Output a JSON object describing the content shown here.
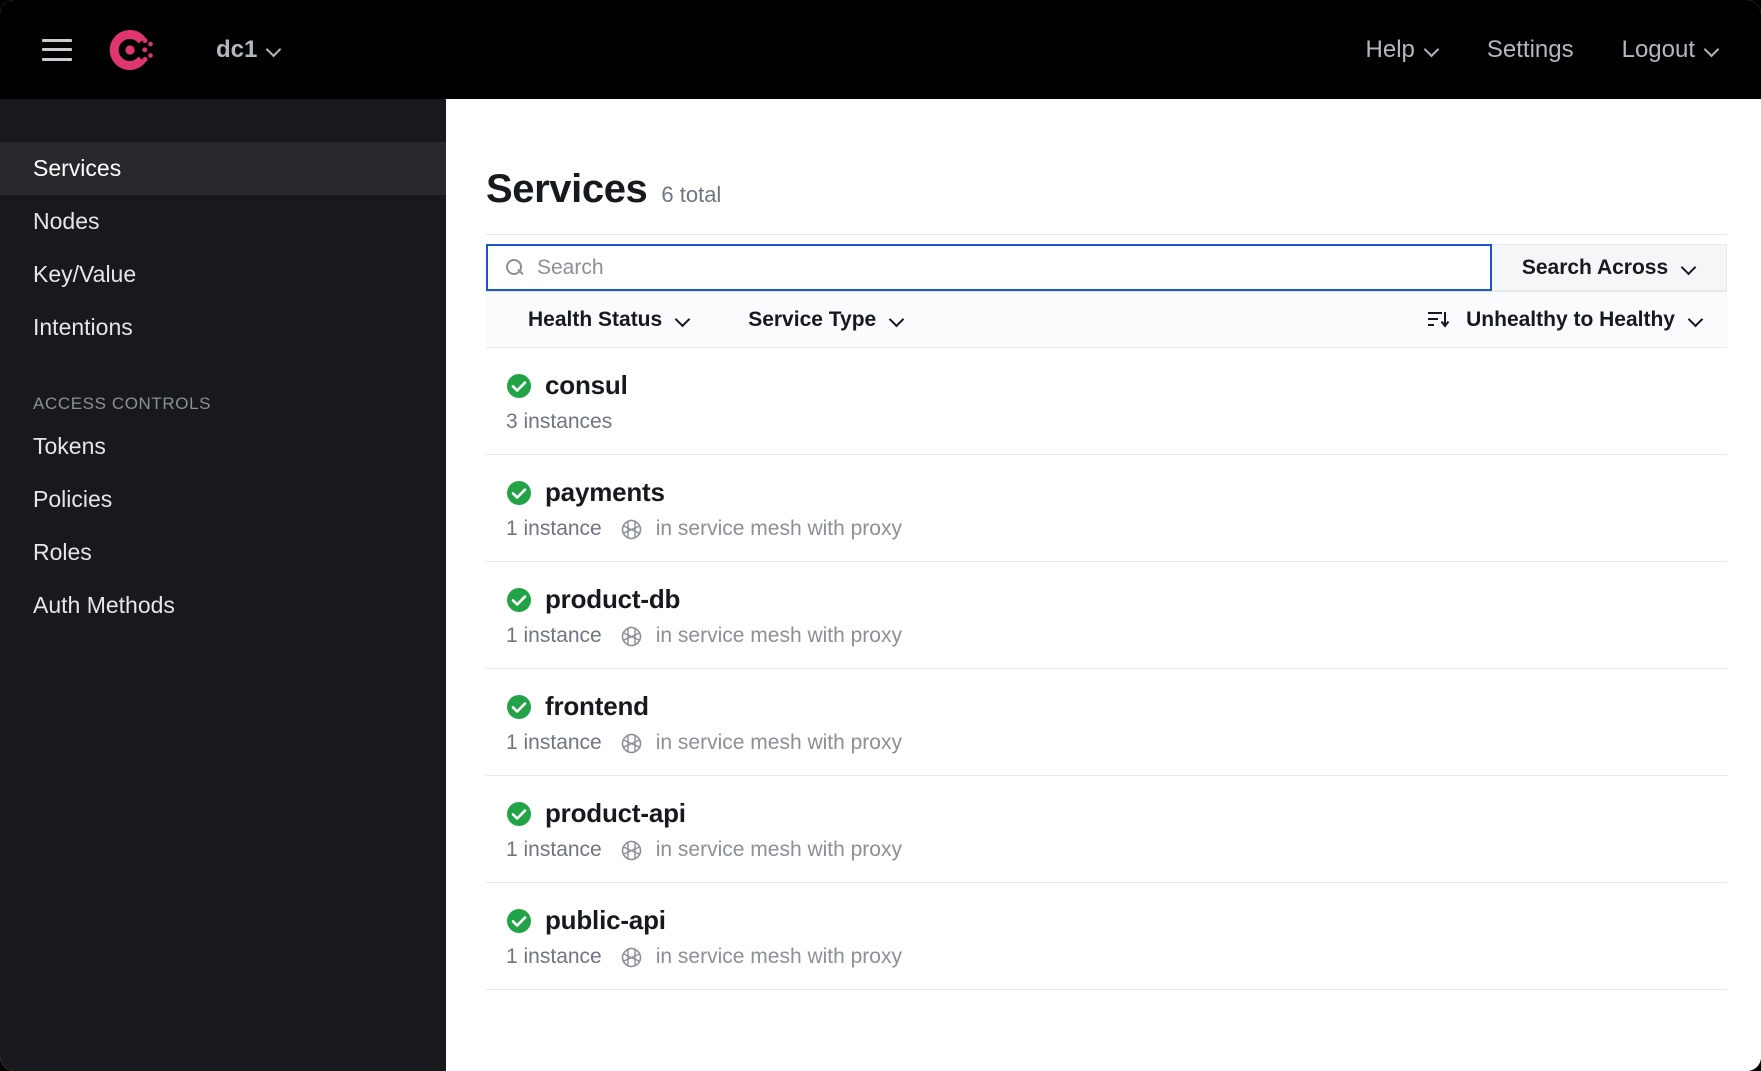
{
  "topnav": {
    "menu_icon": "hamburger-icon",
    "logo": "consul-logo",
    "datacenter": "dc1",
    "links": [
      {
        "label": "Help",
        "has_chevron": true
      },
      {
        "label": "Settings",
        "has_chevron": false
      },
      {
        "label": "Logout",
        "has_chevron": true
      }
    ]
  },
  "sidebar": {
    "items": [
      {
        "label": "Services",
        "active": true
      },
      {
        "label": "Nodes",
        "active": false
      },
      {
        "label": "Key/Value",
        "active": false
      },
      {
        "label": "Intentions",
        "active": false
      }
    ],
    "section_label": "ACCESS CONTROLS",
    "acl_items": [
      {
        "label": "Tokens"
      },
      {
        "label": "Policies"
      },
      {
        "label": "Roles"
      },
      {
        "label": "Auth Methods"
      }
    ]
  },
  "main": {
    "title": "Services",
    "count_label": "6 total",
    "search": {
      "placeholder": "Search",
      "value": "",
      "icon": "search-icon"
    },
    "search_across_label": "Search Across",
    "filters": [
      {
        "label": "Health Status"
      },
      {
        "label": "Service Type"
      }
    ],
    "sort": {
      "icon": "sort-descending-icon",
      "label": "Unhealthy to Healthy"
    },
    "services": [
      {
        "name": "consul",
        "health": "passing",
        "instances": "3 instances",
        "mesh": ""
      },
      {
        "name": "payments",
        "health": "passing",
        "instances": "1 instance",
        "mesh": "in service mesh with proxy"
      },
      {
        "name": "product-db",
        "health": "passing",
        "instances": "1 instance",
        "mesh": "in service mesh with proxy"
      },
      {
        "name": "frontend",
        "health": "passing",
        "instances": "1 instance",
        "mesh": "in service mesh with proxy"
      },
      {
        "name": "product-api",
        "health": "passing",
        "instances": "1 instance",
        "mesh": "in service mesh with proxy"
      },
      {
        "name": "public-api",
        "health": "passing",
        "instances": "1 instance",
        "mesh": "in service mesh with proxy"
      }
    ]
  },
  "colors": {
    "brand_pink": "#e0366f",
    "topnav_bg": "#000000",
    "sidebar_bg": "#17191c",
    "sidebar_active_bg": "#27292d",
    "health_green": "#23a347",
    "focus_blue": "#1a56c4"
  }
}
